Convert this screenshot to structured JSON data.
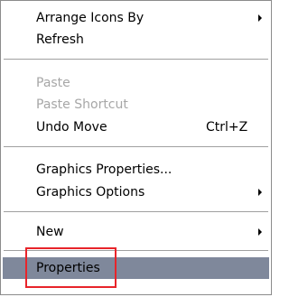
{
  "menu": {
    "items": [
      {
        "label": "Arrange Icons By",
        "submenu": true,
        "enabled": true
      },
      {
        "label": "Refresh",
        "enabled": true
      },
      {
        "label": "Paste",
        "enabled": false
      },
      {
        "label": "Paste Shortcut",
        "enabled": false
      },
      {
        "label": "Undo Move",
        "shortcut": "Ctrl+Z",
        "enabled": true
      },
      {
        "label": "Graphics Properties...",
        "enabled": true
      },
      {
        "label": "Graphics Options",
        "submenu": true,
        "enabled": true
      },
      {
        "label": "New",
        "submenu": true,
        "enabled": true
      },
      {
        "label": "Properties",
        "enabled": true,
        "highlighted": true
      }
    ]
  },
  "colors": {
    "highlight": "#7f889b",
    "disabled_text": "#a7a7a7",
    "annotation_box": "#e8242a"
  }
}
